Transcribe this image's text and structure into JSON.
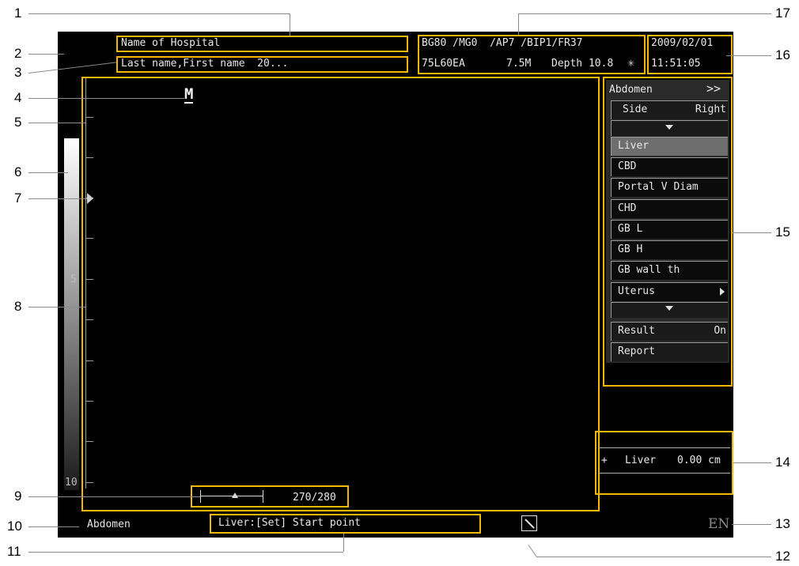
{
  "header": {
    "hospital": "Name of Hospital",
    "patient": "Last name,First name  20...",
    "params_line1": "BG80 /MG0  /AP7 /BIP1/FR37",
    "probe": "75L60EA",
    "freq": "7.5M",
    "depth": "Depth 10.8",
    "freeze_icon": "snowflake-icon",
    "date": "2009/02/01",
    "time": "11:51:05"
  },
  "image_area": {
    "mode_marker": "M",
    "depth_label_5": "5",
    "depth_label_10": "10",
    "frame_counter": "270/280"
  },
  "menu": {
    "title": "Abdomen",
    "title_icon": "double-chevron-right-icon",
    "side_label": "Side",
    "side_value": "Right",
    "scroll_up_icon": "triangle-down-icon",
    "items": [
      "Liver",
      "CBD",
      "Portal V Diam",
      "CHD",
      "GB L",
      "GB H",
      "GB wall th",
      "Uterus"
    ],
    "selected": "Liver",
    "uterus_icon": "triangle-right-icon",
    "scroll_down_icon": "triangle-down-icon",
    "result_label": "Result",
    "result_value": "On",
    "report_label": "Report"
  },
  "measurement": {
    "symbol": "+",
    "label": "Liver",
    "value": "0.00 cm"
  },
  "footer": {
    "exam": "Abdomen",
    "prompt": "Liver:[Set] Start point",
    "caliper_icon": "caliper-line-icon",
    "language": "EN"
  },
  "callouts": [
    "1",
    "2",
    "3",
    "4",
    "5",
    "6",
    "7",
    "8",
    "9",
    "10",
    "11",
    "12",
    "13",
    "14",
    "15",
    "16",
    "17"
  ],
  "colors": {
    "highlight": "#f5b800",
    "screen": "#000000",
    "selected": "#6e6e6e"
  }
}
